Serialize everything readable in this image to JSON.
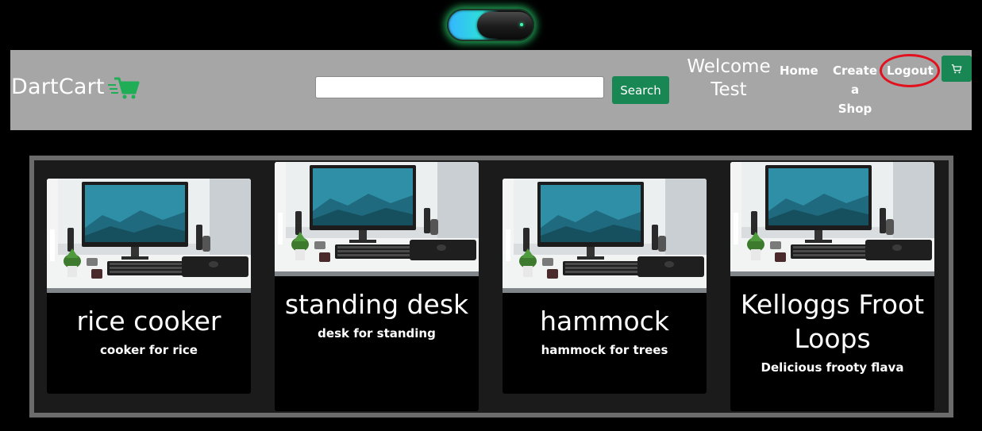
{
  "theme_toggle": {
    "state": "dark",
    "icon": "toggle-switch"
  },
  "header": {
    "brand": "DartCart",
    "brand_icon": "fast-cart-icon",
    "search": {
      "value": "",
      "placeholder": "",
      "button_label": "Search"
    },
    "welcome_line1": "Welcome",
    "welcome_line2": "Test",
    "nav": {
      "home": "Home",
      "create_line1": "Create",
      "create_line2": "a",
      "create_line3": "Shop",
      "logout": "Logout"
    },
    "cart_icon": "cart-icon"
  },
  "colors": {
    "accent": "#198754",
    "header_bg": "#a6a6a6",
    "highlight_circle": "#e3101e"
  },
  "products": [
    {
      "title": "rice cooker",
      "description": "cooker for rice"
    },
    {
      "title": "standing desk",
      "description": "desk for standing"
    },
    {
      "title": "hammock",
      "description": "hammock for trees"
    },
    {
      "title": "Kelloggs Froot Loops",
      "description": "Delicious frooty flava"
    }
  ]
}
